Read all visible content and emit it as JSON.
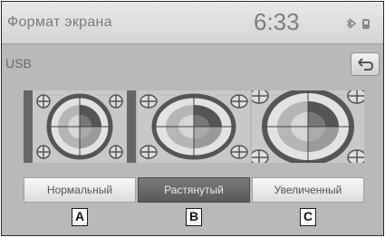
{
  "header": {
    "title": "Формат экрана",
    "clock": "6:33",
    "status_icons": [
      "bluetooth-icon",
      "signal-icon"
    ]
  },
  "source_label": "USB",
  "back_button": {
    "icon": "back-arrow-icon"
  },
  "modes": [
    {
      "label": "Нормальный",
      "selected": false,
      "tag": "A"
    },
    {
      "label": "Растянутый",
      "selected": true,
      "tag": "B"
    },
    {
      "label": "Увеличенный",
      "selected": false,
      "tag": "C"
    }
  ],
  "colors": {
    "screen_bg": "#b9b9b9",
    "selected_button": "#666666",
    "target_dark": "#555555",
    "target_mid": "#9a9a9a"
  }
}
